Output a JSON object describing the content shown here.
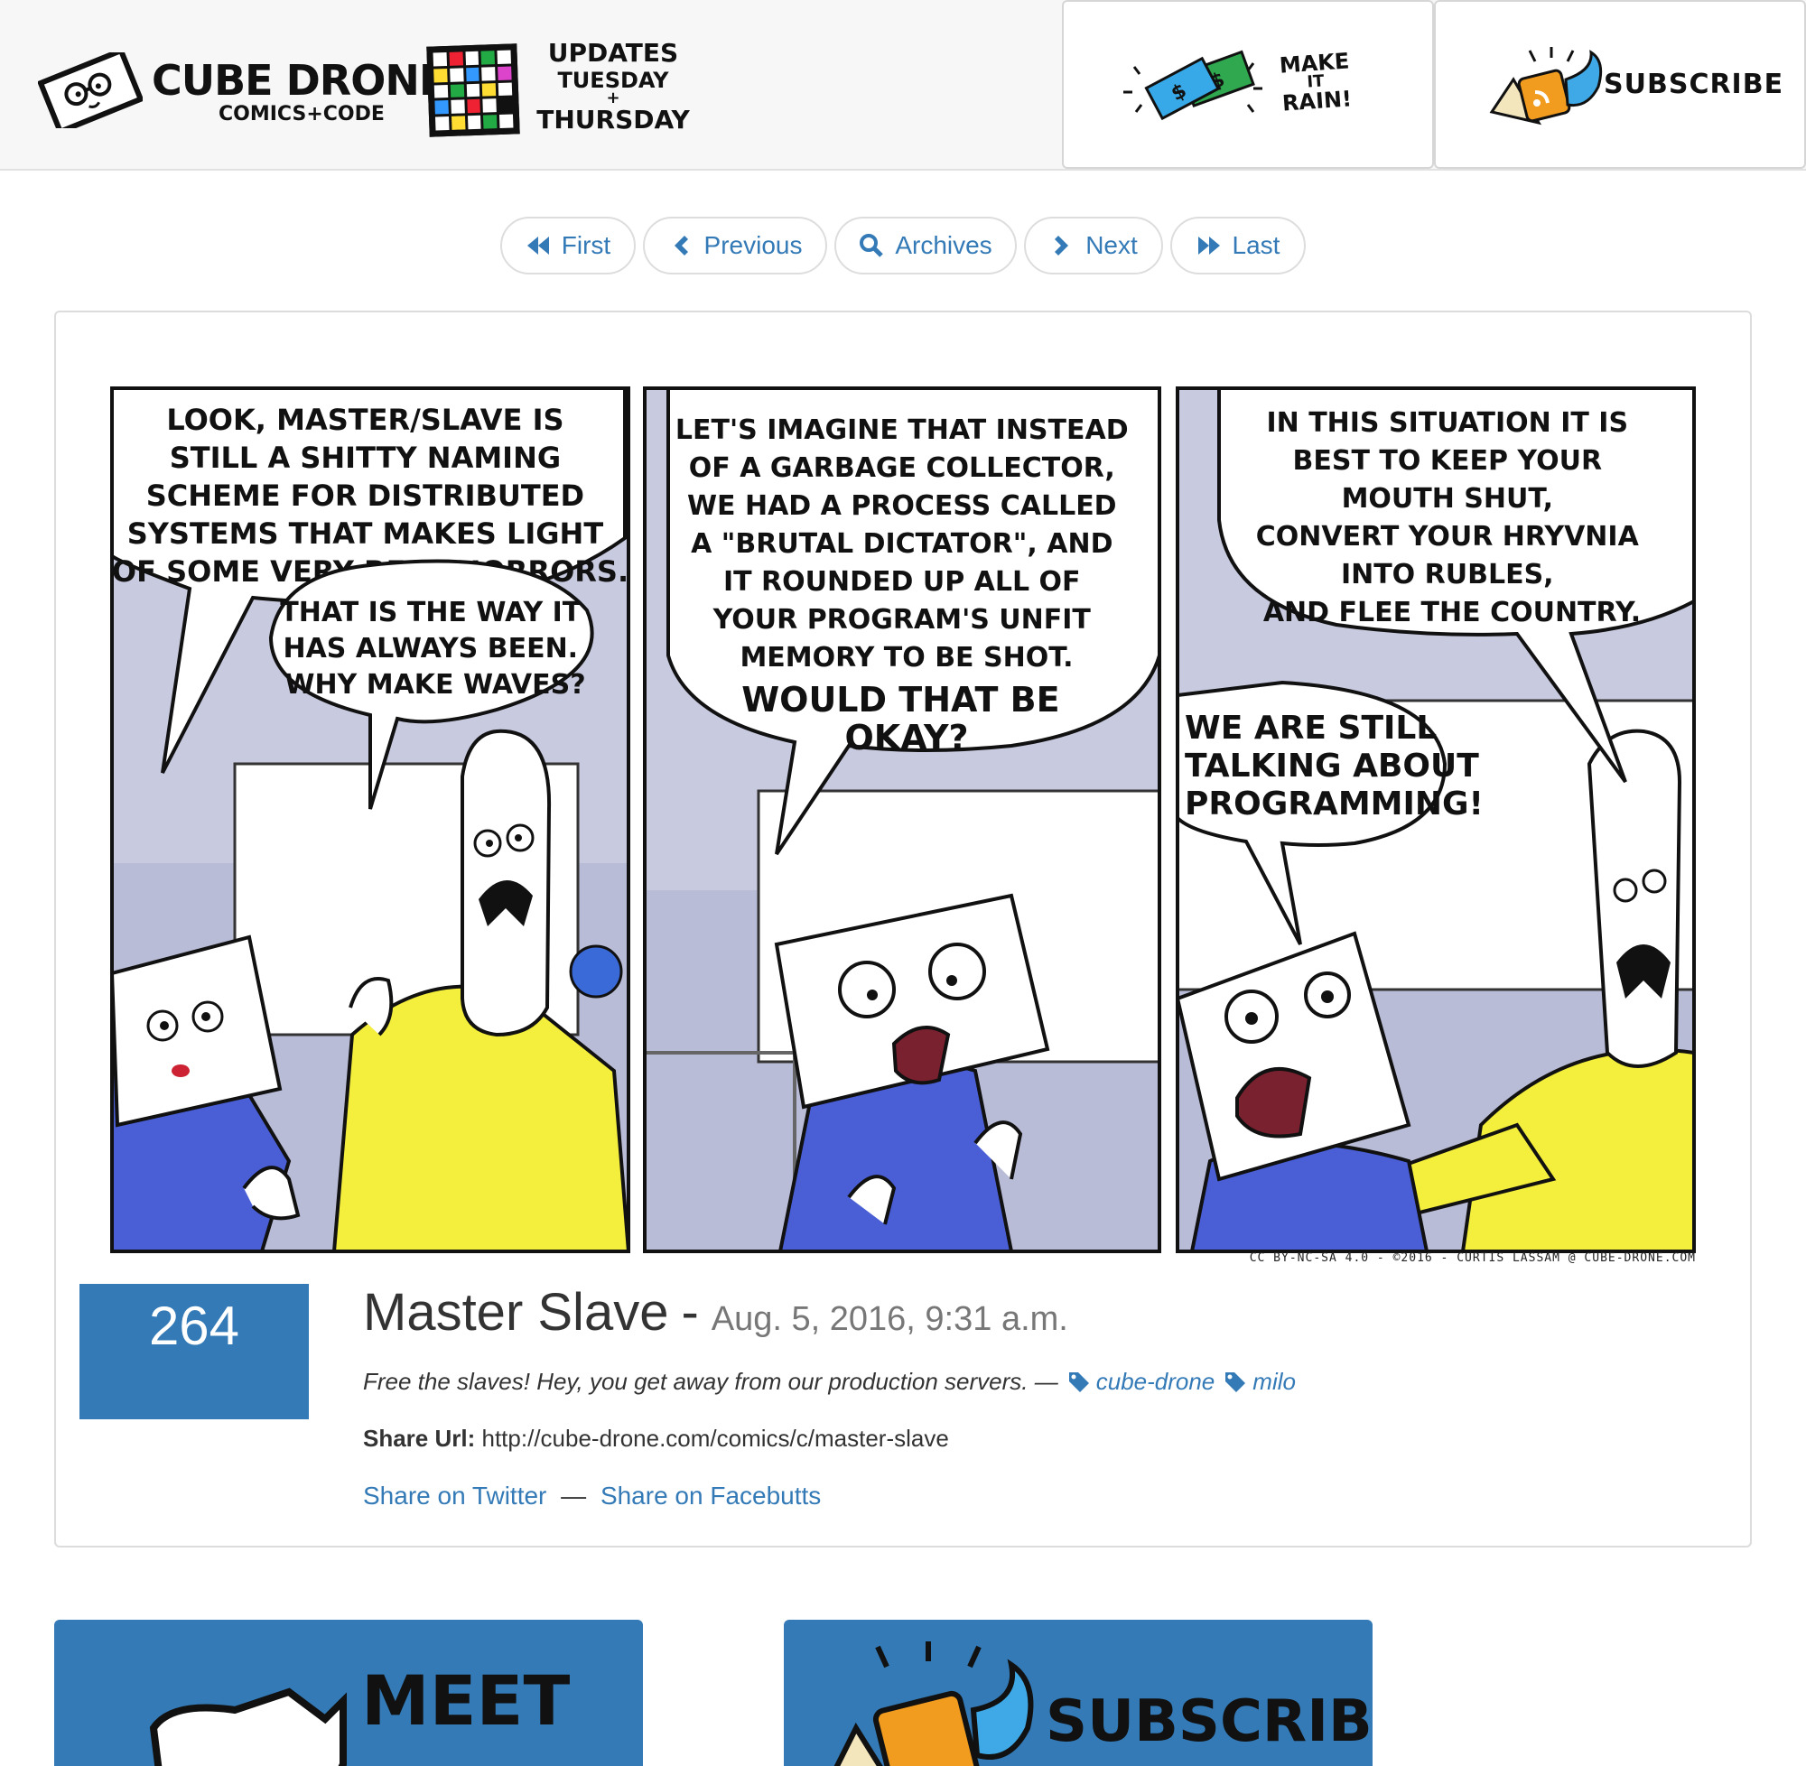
{
  "header": {
    "logo_title": "Cube Drone",
    "logo_subtitle": "Comics+Code",
    "schedule_line1": "Updates",
    "schedule_line2": "Tuesday",
    "schedule_plus": "+",
    "schedule_line3": "Thursday",
    "rain_line1": "Make",
    "rain_line2": "it",
    "rain_line3": "Rain!",
    "subscribe_label": "Subscribe"
  },
  "nav": {
    "first": "First",
    "previous": "Previous",
    "archives": "Archives",
    "next": "Next",
    "last": "Last"
  },
  "comic": {
    "panel1_bubble1": [
      "LOOK, MASTER/SLAVE IS",
      "STILL A SHITTY NAMING",
      "SCHEME FOR DISTRIBUTED",
      "SYSTEMS THAT MAKES LIGHT",
      "OF SOME VERY REAL HORRORS."
    ],
    "panel1_bubble2": [
      "THAT IS THE WAY IT",
      "HAS ALWAYS BEEN.",
      "WHY MAKE WAVES?"
    ],
    "panel2_bubble1": [
      "LET'S IMAGINE THAT INSTEAD",
      "OF A GARBAGE COLLECTOR,",
      "WE HAD A PROCESS CALLED",
      "A \"BRUTAL DICTATOR\", AND",
      "IT ROUNDED UP ALL OF",
      "YOUR PROGRAM'S UNFIT",
      "MEMORY TO BE SHOT."
    ],
    "panel2_bubble1_bold": [
      "WOULD THAT BE",
      "OKAY?"
    ],
    "panel3_bubble1": [
      "IN THIS SITUATION IT IS",
      "BEST TO KEEP YOUR",
      "MOUTH SHUT,",
      "CONVERT YOUR HRYVNIA",
      "INTO RUBLES,",
      "AND FLEE THE COUNTRY."
    ],
    "panel3_bubble2": [
      "WE ARE STILL",
      "TALKING ABOUT",
      "PROGRAMMING!"
    ],
    "credit": "CC BY-NC-SA 4.0 - ©2016 - CURTIS LASSAM @ CUBE-DRONE.COM",
    "colors": {
      "blue_shirt": "#4a5fd6",
      "yellow_hoodie": "#f4ee3c",
      "wall": "#c8cadf",
      "whiteboard": "#ffffff"
    }
  },
  "post": {
    "number": "264",
    "title": "Master Slave",
    "separator": "-",
    "date": "Aug. 5, 2016, 9:31 a.m.",
    "description": "Free the slaves! Hey, you get away from our production servers. —",
    "tags": [
      "cube-drone",
      "milo"
    ],
    "share_url_label": "Share Url:",
    "share_url": "http://cube-drone.com/comics/c/master-slave",
    "share_twitter": "Share on Twitter",
    "share_sep": "—",
    "share_facebook": "Share on Facebutts"
  },
  "bottom": {
    "meet_label": "Meet",
    "subscribe_label": "Subscribe"
  },
  "colors": {
    "link": "#337ab7",
    "badge": "#337ab7",
    "header_bg": "#f7f7f7"
  }
}
